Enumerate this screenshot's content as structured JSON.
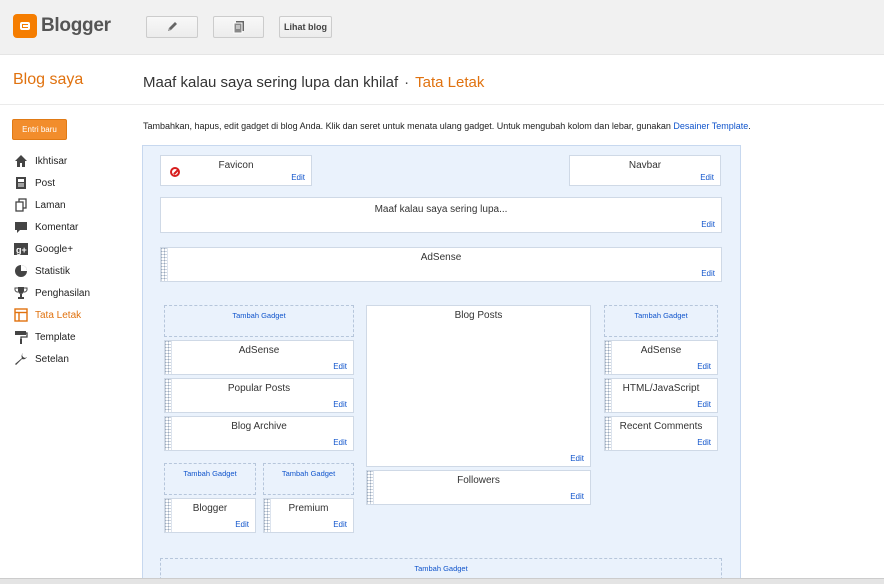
{
  "topbar": {
    "logo_text": "Blogger",
    "pencil_icon": "pencil-icon",
    "posts_icon": "copy-icon",
    "view_blog_label": "Lihat blog"
  },
  "sidebar": {
    "title": "Blog saya",
    "new_post_label": "Entri baru",
    "items": [
      {
        "label": "Ikhtisar",
        "icon": "home-icon",
        "active": false
      },
      {
        "label": "Post",
        "icon": "post-icon",
        "active": false
      },
      {
        "label": "Laman",
        "icon": "pages-icon",
        "active": false
      },
      {
        "label": "Komentar",
        "icon": "comment-icon",
        "active": false
      },
      {
        "label": "Google+",
        "icon": "google-plus-icon",
        "active": false
      },
      {
        "label": "Statistik",
        "icon": "stats-icon",
        "active": false
      },
      {
        "label": "Penghasilan",
        "icon": "trophy-icon",
        "active": false
      },
      {
        "label": "Tata Letak",
        "icon": "layout-icon",
        "active": true
      },
      {
        "label": "Template",
        "icon": "paint-roller-icon",
        "active": false
      },
      {
        "label": "Setelan",
        "icon": "wrench-icon",
        "active": false
      }
    ]
  },
  "header": {
    "blog_name": "Maaf kalau saya sering lupa dan khilaf",
    "separator": "·",
    "section": "Tata Letak"
  },
  "instructions": {
    "text": "Tambahkan, hapus, edit gadget di blog Anda. Klik dan seret untuk menata ulang gadget. Untuk mengubah kolom dan lebar, gunakan",
    "link": "Desainer Template",
    "end": "."
  },
  "layout": {
    "edit_label": "Edit",
    "add_gadget_label": "Tambah Gadget",
    "favicon": "Favicon",
    "navbar": "Navbar",
    "header": "Maaf kalau saya sering lupa...",
    "adsense_top": "AdSense",
    "left_sidebar": [
      "AdSense",
      "Popular Posts",
      "Blog Archive"
    ],
    "main": "Blog Posts",
    "followers": "Followers",
    "right_sidebar": [
      "AdSense",
      "HTML/JavaScript",
      "Recent Comments"
    ],
    "footer_left": "Blogger",
    "footer_right": "Premium"
  }
}
